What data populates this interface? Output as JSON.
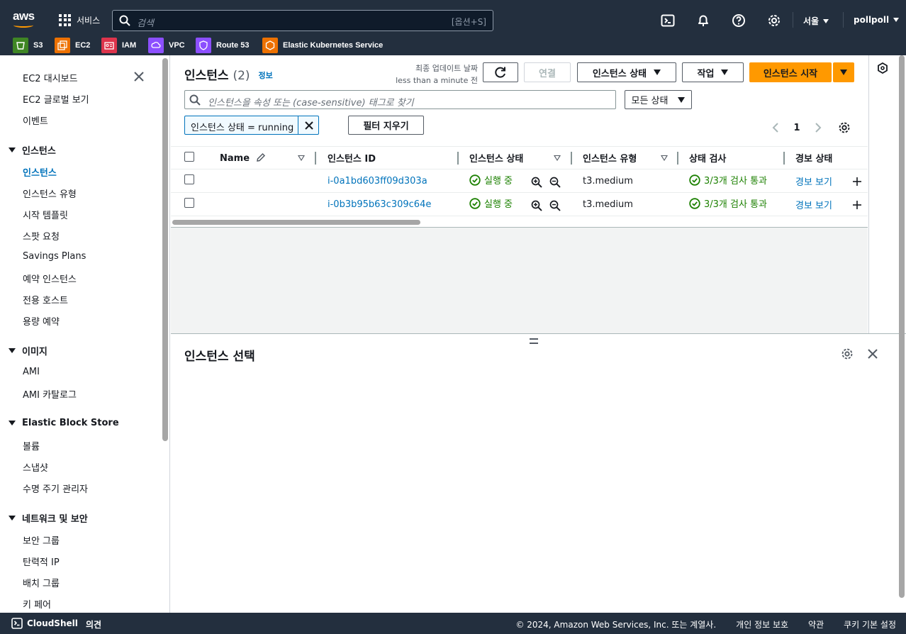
{
  "nav": {
    "logo": "aws",
    "services": "서비스",
    "search_placeholder": "검색",
    "search_shortcut": "[옵션+S]",
    "region": "서울",
    "user": "pollpoll",
    "icons": [
      "cloudshell-icon",
      "notification-bell-icon",
      "help-icon",
      "settings-gear-icon"
    ]
  },
  "favorites": [
    {
      "label": "S3",
      "color": "#3f8624"
    },
    {
      "label": "EC2",
      "color": "#ed7100"
    },
    {
      "label": "IAM",
      "color": "#dd344c"
    },
    {
      "label": "VPC",
      "color": "#8c4fff"
    },
    {
      "label": "Route 53",
      "color": "#8c4fff"
    },
    {
      "label": "Elastic Kubernetes Service",
      "color": "#ed7100"
    }
  ],
  "sidebar": {
    "top": [
      "EC2 대시보드",
      "EC2 글로벌 보기",
      "이벤트"
    ],
    "sections": [
      {
        "title": "인스턴스",
        "items": [
          "인스턴스",
          "인스턴스 유형",
          "시작 템플릿",
          "스팟 요청",
          "Savings Plans",
          "예약 인스턴스",
          "전용 호스트",
          "용량 예약"
        ]
      },
      {
        "title": "이미지",
        "items": [
          "AMI",
          "AMI 카탈로그"
        ]
      },
      {
        "title": "Elastic Block Store",
        "items": [
          "볼륨",
          "스냅샷",
          "수명 주기 관리자"
        ]
      },
      {
        "title": "네트워크 및 보안",
        "items": [
          "보안 그룹",
          "탄력적 IP",
          "배치 그룹",
          "키 페어"
        ]
      }
    ]
  },
  "instances": {
    "title": "인스턴스",
    "count": "(2)",
    "info": "정보",
    "updated_label": "최종 업데이트 날짜",
    "updated_value": "less than a minute 전",
    "btn_connect": "연결",
    "btn_state": "인스턴스 상태",
    "btn_actions": "작업",
    "btn_launch": "인스턴스 시작",
    "filter_placeholder": "인스턴스을 속성 또는 (case-sensitive) 태그로 찾기",
    "state_filter": "모든 상태",
    "token": "인스턴스 상태 = running",
    "clear_filters": "필터 지우기",
    "page": "1",
    "columns": [
      "Name",
      "인스턴스 ID",
      "인스턴스 상태",
      "인스턴스 유형",
      "상태 검사",
      "경보 상태"
    ],
    "rows": [
      {
        "name": "",
        "id": "i-0a1bd603ff09d303a",
        "state": "실행 중",
        "type": "t3.medium",
        "check": "3/3개 검사 통과",
        "alarm": "경보 보기"
      },
      {
        "name": "",
        "id": "i-0b3b95b63c309c64e",
        "state": "실행 중",
        "type": "t3.medium",
        "check": "3/3개 검사 통과",
        "alarm": "경보 보기"
      }
    ]
  },
  "split": {
    "title": "인스턴스 선택"
  },
  "footer": {
    "cloudshell": "CloudShell",
    "feedback": "의견",
    "copyright": "© 2024, Amazon Web Services, Inc. 또는 계열사.",
    "privacy": "개인 정보 보호",
    "terms": "약관",
    "cookies": "쿠키 기본 설정"
  }
}
